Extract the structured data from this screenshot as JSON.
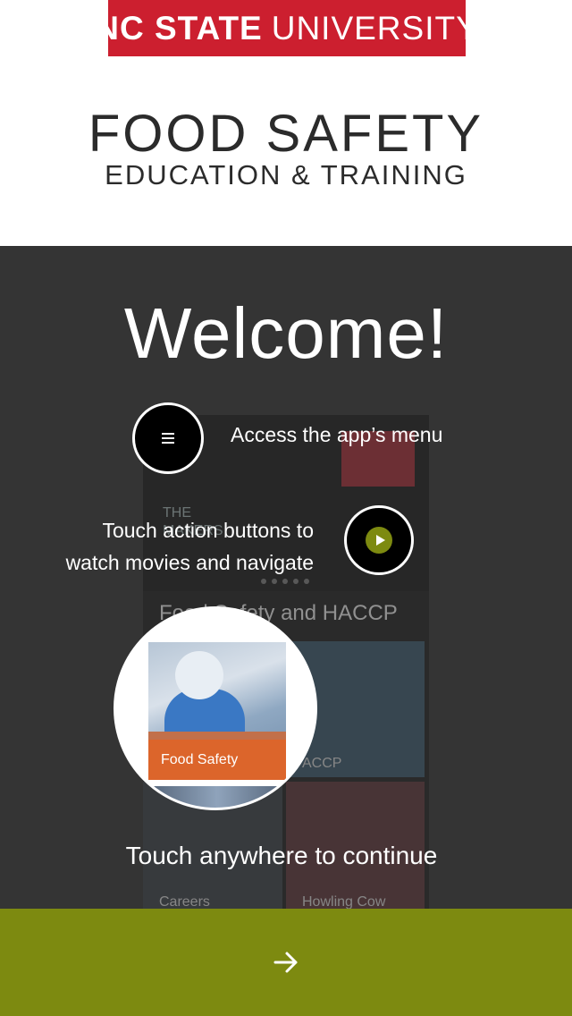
{
  "header": {
    "brand_bold": "NC STATE",
    "brand_light": "UNIVERSITY",
    "title": "FOOD SAFETY",
    "subtitle": "EDUCATION & TRAINING"
  },
  "overlay": {
    "welcome": "Welcome!",
    "menu_hint": "Access the app’s menu",
    "action_hint_line1": "Touch action buttons to",
    "action_hint_line2": "watch movies and navigate",
    "tile_label": "Food Safety",
    "continue_hint": "Touch anywhere to continue"
  },
  "preview": {
    "hero_line1": "THE",
    "hero_line2": "MAKERS",
    "section_title": "Food Safety and HACCP",
    "tiles": [
      {
        "label": ""
      },
      {
        "label": "ACCP"
      },
      {
        "label": "Careers"
      },
      {
        "label": "Howling Cow"
      }
    ]
  },
  "icons": {
    "menu": "hamburger-icon",
    "play": "play-icon",
    "next": "arrow-right-icon"
  },
  "colors": {
    "brand_red": "#cc1f2f",
    "accent_green": "#7d8a10",
    "overlay_bg": "#343434"
  }
}
